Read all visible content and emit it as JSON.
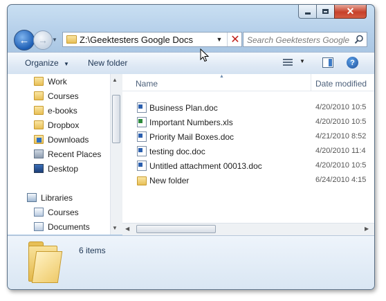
{
  "address": {
    "path": "Z:\\Geektesters Google Docs"
  },
  "search": {
    "placeholder": "Search Geektesters Google Docs"
  },
  "toolbar": {
    "organize_label": "Organize",
    "new_folder_label": "New folder"
  },
  "navigation": {
    "items": [
      {
        "label": "Work",
        "icon": "folder-icon"
      },
      {
        "label": "Courses",
        "icon": "folder-icon"
      },
      {
        "label": "e-books",
        "icon": "folder-icon"
      },
      {
        "label": "Dropbox",
        "icon": "folder-icon"
      },
      {
        "label": "Downloads",
        "icon": "downloads-folder-icon"
      },
      {
        "label": "Recent Places",
        "icon": "recent-places-icon"
      },
      {
        "label": "Desktop",
        "icon": "desktop-icon"
      },
      {
        "label": "Libraries",
        "icon": "libraries-icon"
      },
      {
        "label": "Courses",
        "icon": "library-icon"
      },
      {
        "label": "Documents",
        "icon": "documents-library-icon"
      }
    ]
  },
  "columns": {
    "name": "Name",
    "date_modified": "Date modified"
  },
  "files": [
    {
      "name": "Business Plan.doc",
      "date": "4/20/2010 10:5",
      "type": "doc"
    },
    {
      "name": "Important Numbers.xls",
      "date": "4/20/2010 10:5",
      "type": "xls"
    },
    {
      "name": "Priority Mail Boxes.doc",
      "date": "4/21/2010 8:52",
      "type": "doc"
    },
    {
      "name": "testing doc.doc",
      "date": "4/20/2010 11:4",
      "type": "doc"
    },
    {
      "name": "Untitled attachment 00013.doc",
      "date": "4/20/2010 10:5",
      "type": "doc"
    },
    {
      "name": "New folder",
      "date": "6/24/2010 4:15",
      "type": "folder"
    }
  ],
  "details": {
    "count_text": "6 items"
  },
  "colors": {
    "accent": "#1e5fb5",
    "close": "#c7402a",
    "folder": "#e7bf56"
  }
}
